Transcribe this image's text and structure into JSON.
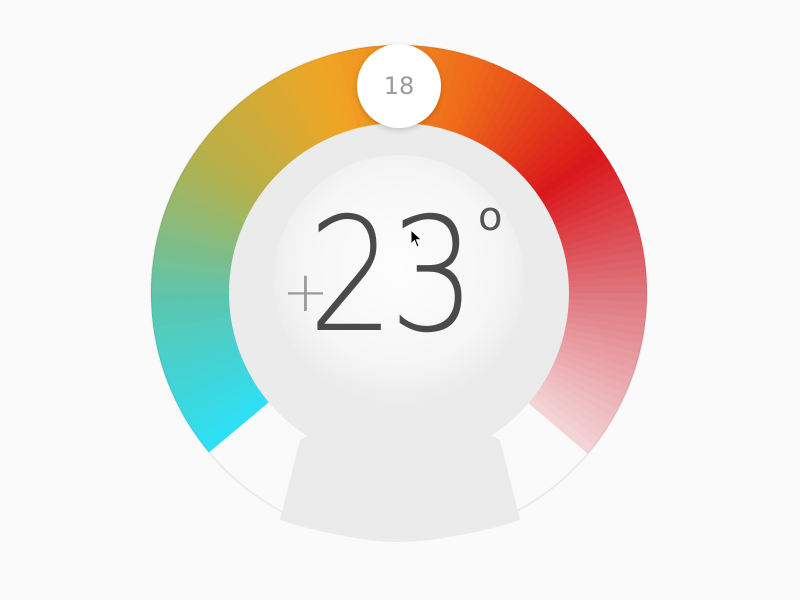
{
  "thermostat": {
    "current_value": "23",
    "sign": "+",
    "unit": "o",
    "knob_value": "18"
  },
  "colors": {
    "background": "#fafafa",
    "inner_face": "#ebebeb",
    "center_glow": "#fbfbfb",
    "gradient_stops": [
      "#2ee0f5",
      "#5bc6b0",
      "#b6b04a",
      "#f0a523",
      "#ef6a1a",
      "#d9171b",
      "#e07b83",
      "#f3d3d6"
    ]
  },
  "icons": {
    "pointer": "arrow-cursor-icon"
  }
}
